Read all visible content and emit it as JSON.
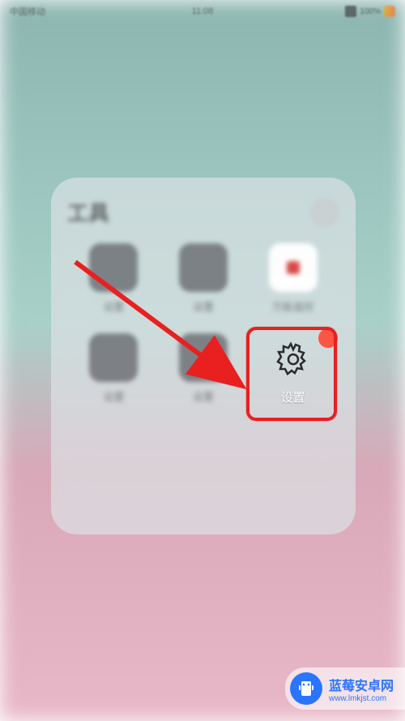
{
  "statusbar": {
    "carrier": "中国移动",
    "time": "11:08",
    "battery": "100%"
  },
  "folder": {
    "title": "工具",
    "apps": [
      {
        "label": "设置",
        "kind": "dark"
      },
      {
        "label": "设置",
        "kind": "dark"
      },
      {
        "label": "万能遥控",
        "kind": "white"
      },
      {
        "label": "设置",
        "kind": "dark"
      },
      {
        "label": "设置",
        "kind": "dark"
      }
    ],
    "settings_label": "设置"
  },
  "watermark": {
    "title": "蓝莓安卓网",
    "url": "www.lmkjst.com"
  }
}
